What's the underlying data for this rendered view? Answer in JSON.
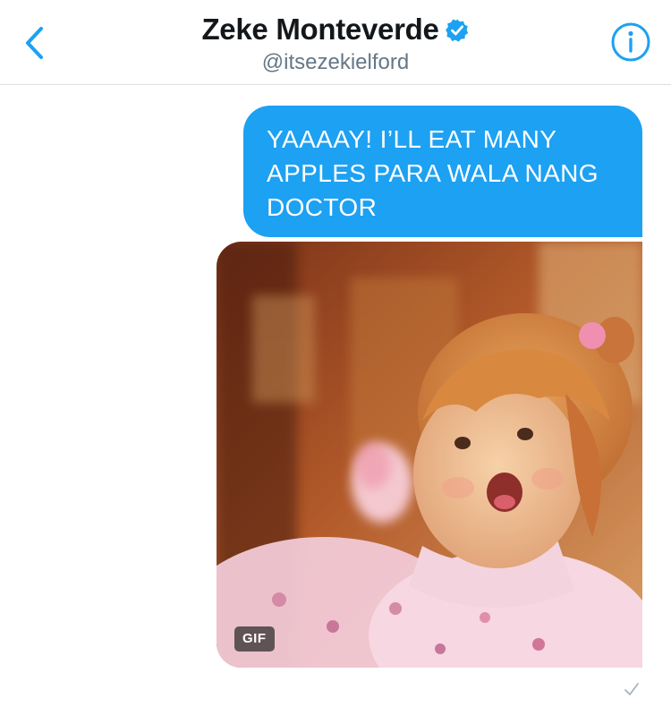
{
  "header": {
    "display_name": "Zeke Monteverde",
    "handle": "@itsezekielford",
    "verified": true,
    "icons": {
      "back": "chevron-left-icon",
      "verified": "verified-badge-icon",
      "info": "info-icon"
    },
    "accent_color": "#1da1f2"
  },
  "conversation": {
    "messages": [
      {
        "type": "text",
        "direction": "outgoing",
        "text": "YAAAAY! I’LL EAT MANY APPLES PARA WALA NANG DOCTOR"
      },
      {
        "type": "gif",
        "direction": "outgoing",
        "badge": "GIF"
      }
    ],
    "status_icon": "checkmark-sent-icon"
  }
}
